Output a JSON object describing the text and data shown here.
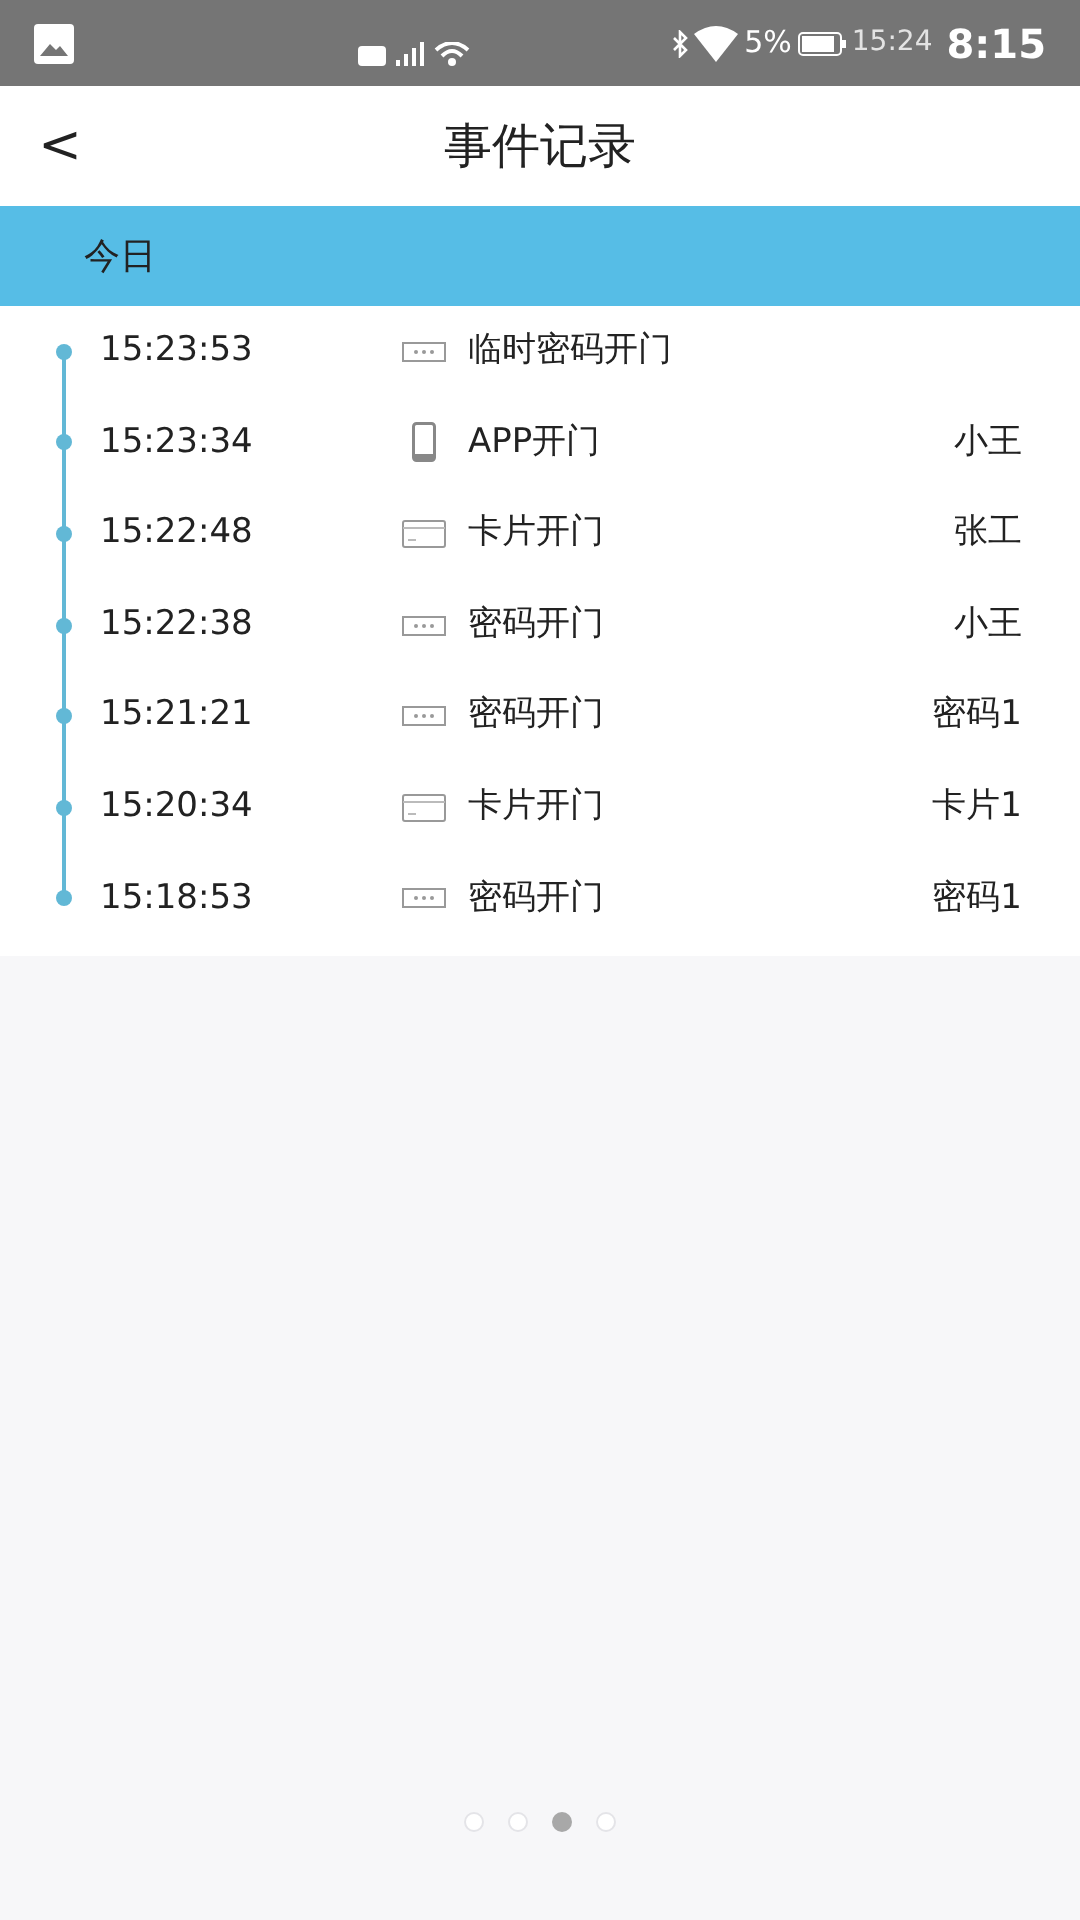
{
  "status_bar": {
    "battery_percent": "5%",
    "time_small": "15:24",
    "time": "8:15"
  },
  "header": {
    "back": "<",
    "title": "事件记录"
  },
  "section": {
    "label": "今日"
  },
  "events": [
    {
      "time": "15:23:53",
      "kind": "keypad",
      "action": "临时密码开门"
    },
    {
      "time": "15:23:34",
      "kind": "phone",
      "action": "APP开门",
      "user": "小王"
    },
    {
      "time": "15:22:48",
      "kind": "card",
      "action": "卡片开门",
      "user": "张工"
    },
    {
      "time": "15:22:38",
      "kind": "keypad",
      "action": "密码开门",
      "user": "小王"
    },
    {
      "time": "15:21:21",
      "kind": "keypad",
      "action": "密码开门",
      "user": "密码1"
    },
    {
      "time": "15:20:34",
      "kind": "card",
      "action": "卡片开门",
      "user": "卡片1"
    },
    {
      "time": "15:18:53",
      "kind": "keypad",
      "action": "密码开门",
      "user": "密码1"
    }
  ],
  "page_dots": [
    {
      "selected": false
    },
    {
      "selected": false
    },
    {
      "selected": true
    },
    {
      "selected": false
    }
  ]
}
